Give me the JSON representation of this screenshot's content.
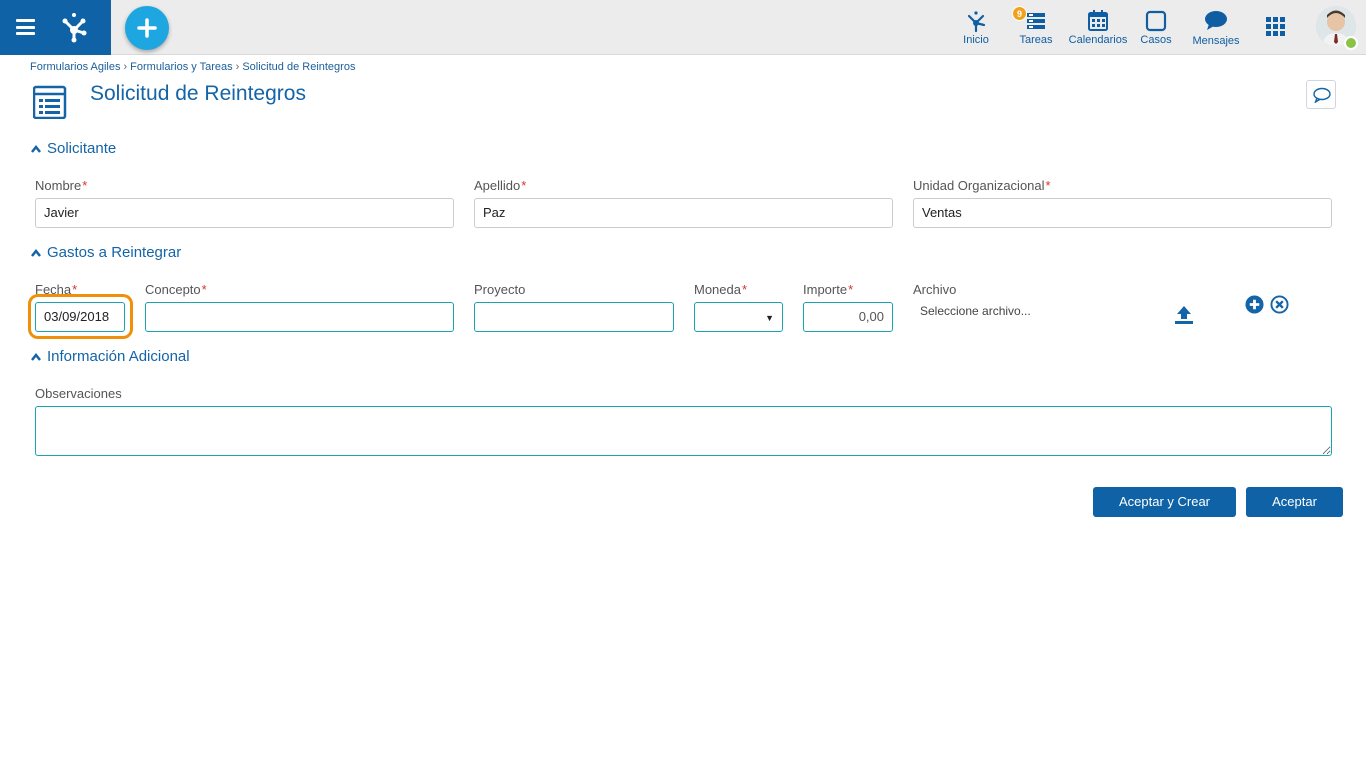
{
  "nav": {
    "items": [
      {
        "label": "Inicio",
        "icon": "home-icon"
      },
      {
        "label": "Tareas",
        "icon": "tasks-icon",
        "badge": "9"
      },
      {
        "label": "Calendarios",
        "icon": "calendar-icon"
      },
      {
        "label": "Casos",
        "icon": "cases-icon"
      },
      {
        "label": "Mensajes",
        "icon": "messages-icon"
      }
    ],
    "apps_icon": "apps-grid-icon"
  },
  "breadcrumb": [
    "Formularios Agiles",
    "Formularios y Tareas",
    "Solicitud de Reintegros"
  ],
  "page_title": "Solicitud de Reintegros",
  "sections": {
    "solicitante": {
      "title": "Solicitante",
      "nombre": {
        "label": "Nombre",
        "value": "Javier"
      },
      "apellido": {
        "label": "Apellido",
        "value": "Paz"
      },
      "unidad": {
        "label": "Unidad Organizacional",
        "value": "Ventas"
      }
    },
    "gastos": {
      "title": "Gastos a Reintegrar",
      "fecha": {
        "label": "Fecha",
        "value": "03/09/2018"
      },
      "concepto": {
        "label": "Concepto",
        "value": ""
      },
      "proyecto": {
        "label": "Proyecto",
        "value": ""
      },
      "moneda": {
        "label": "Moneda",
        "value": ""
      },
      "importe": {
        "label": "Importe",
        "value": "0,00"
      },
      "archivo": {
        "label": "Archivo",
        "placeholder": "Seleccione archivo..."
      }
    },
    "info": {
      "title": "Información Adicional",
      "observaciones": {
        "label": "Observaciones",
        "value": ""
      }
    }
  },
  "required_mark": "*",
  "buttons": {
    "accept_create": "Aceptar y Crear",
    "accept": "Aceptar"
  },
  "colors": {
    "brand": "#0f62a6",
    "accent": "#1ea6e0",
    "highlight": "#f0900a",
    "required": "#d9332b",
    "badge": "#f0a21c"
  }
}
